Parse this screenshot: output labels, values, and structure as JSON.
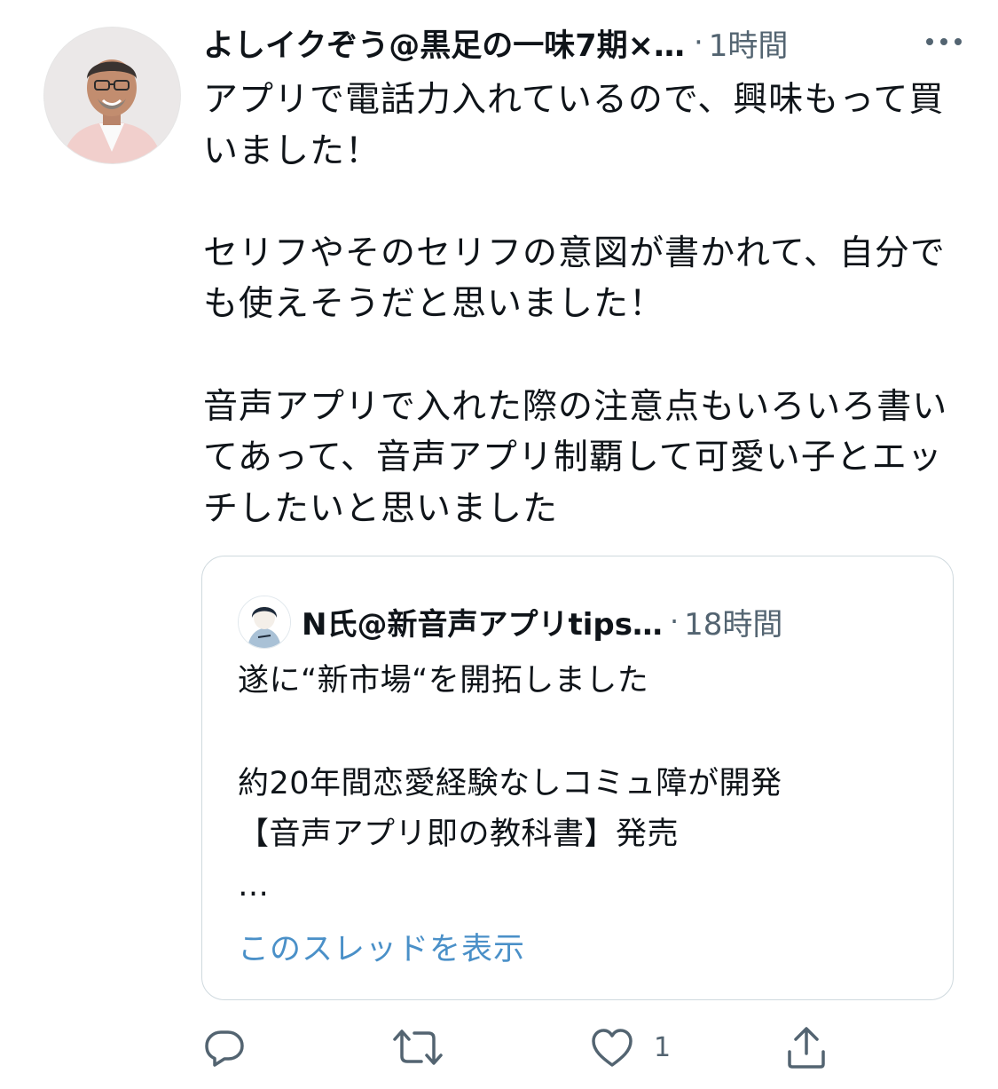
{
  "tweet": {
    "author_name": "よしイクぞう@黒足の一味7期×…",
    "separator": "·",
    "time": "1時間",
    "text": "アプリで電話力入れているので、興味もって買いました！\n\nセリフやそのセリフの意図が書かれて、自分でも使えそうだと思いました！\n\n音声アプリで入れた際の注意点もいろいろ書いてあって、音声アプリ制覇して可愛い子とエッチしたいと思いました"
  },
  "quoted_tweet": {
    "author_name": "N氏@新音声アプリtips…",
    "separator": "·",
    "time": "18時間",
    "text": "遂に“新市場“を開拓しました\n\n約20年間恋愛経験なしコミュ障が開発\n【音声アプリ即の教科書】発売\n…",
    "show_thread": "このスレッドを表示"
  },
  "actions": {
    "reply_count": "",
    "retweet_count": "",
    "like_count": "1",
    "share_count": ""
  },
  "icons": {
    "more": "more-icon",
    "reply": "reply-icon",
    "retweet": "retweet-icon",
    "like": "heart-icon",
    "share": "share-icon"
  },
  "colors": {
    "text": "#0f1419",
    "secondary": "#536471",
    "link": "#4a90c8",
    "border": "#cfd9de"
  }
}
